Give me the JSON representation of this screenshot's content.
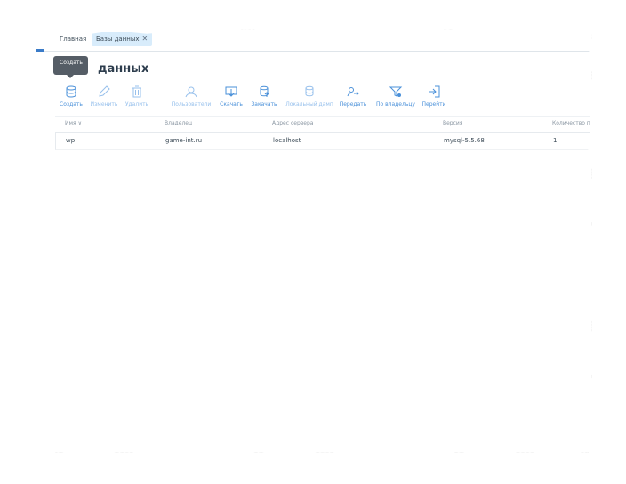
{
  "tabs": {
    "home": "Главная",
    "databases": "Базы данных",
    "close": "✕"
  },
  "page": {
    "title": "данных",
    "tooltip": "Создать"
  },
  "toolbar": [
    {
      "label": "Создать",
      "icon": "database-add-icon",
      "disabled": false
    },
    {
      "label": "Изменить",
      "icon": "pencil-icon",
      "disabled": true
    },
    {
      "label": "Удалить",
      "icon": "trash-icon",
      "disabled": true
    },
    {
      "label": "Пользователи",
      "icon": "users-icon",
      "disabled": true
    },
    {
      "label": "Скачать",
      "icon": "download-icon",
      "disabled": false
    },
    {
      "label": "Закачать",
      "icon": "upload-icon",
      "disabled": false
    },
    {
      "label": "Локальный дамп",
      "icon": "local-dump-icon",
      "disabled": true
    },
    {
      "label": "Передать",
      "icon": "transfer-icon",
      "disabled": false
    },
    {
      "label": "По владельцу",
      "icon": "filter-owner-icon",
      "disabled": false
    },
    {
      "label": "Перейти",
      "icon": "goto-icon",
      "disabled": false
    }
  ],
  "table": {
    "headers": [
      "Имя",
      "Владелец",
      "Адрес сервера",
      "Версия",
      "Количество п"
    ],
    "sort_indicator": "∨",
    "rows": [
      [
        "wp",
        "game-int.ru",
        "localhost",
        "mysql-5.5.68",
        "1"
      ]
    ]
  },
  "colors": {
    "accent": "#4a90d9",
    "tab_active_bg": "#d8ecfb",
    "title": "#2d3d4d"
  }
}
